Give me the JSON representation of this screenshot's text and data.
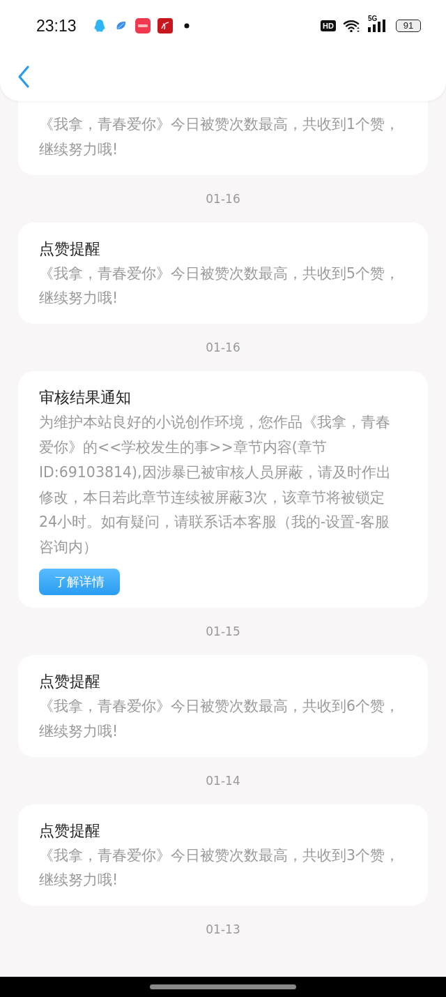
{
  "status_bar": {
    "time": "23:13",
    "hd": "HD",
    "network": "5G",
    "battery": "91"
  },
  "items": [
    {
      "kind": "partial",
      "body": "《我拿，青春爱你》今日被赞次数最高，共收到1个赞，继续努力哦!",
      "date": "01-16"
    },
    {
      "kind": "like",
      "title": "点赞提醒",
      "body": "《我拿，青春爱你》今日被赞次数最高，共收到5个赞，继续努力哦!",
      "date": "01-16"
    },
    {
      "kind": "review",
      "title": "审核结果通知",
      "body": "为维护本站良好的小说创作环境，您作品《我拿，青春爱你》的<<学校发生的事>>章节内容(章节ID:69103814),因涉暴已被审核人员屏蔽，请及时作出修改，本日若此章节连续被屏蔽3次，该章节将被锁定24小时。如有疑问，请联系话本客服（我的-设置-客服咨询内）",
      "button": "了解详情",
      "date": "01-15"
    },
    {
      "kind": "like",
      "title": "点赞提醒",
      "body": "《我拿，青春爱你》今日被赞次数最高，共收到6个赞，继续努力哦!",
      "date": "01-14"
    },
    {
      "kind": "like",
      "title": "点赞提醒",
      "body": "《我拿，青春爱你》今日被赞次数最高，共收到3个赞，继续努力哦!",
      "date": "01-13"
    }
  ]
}
